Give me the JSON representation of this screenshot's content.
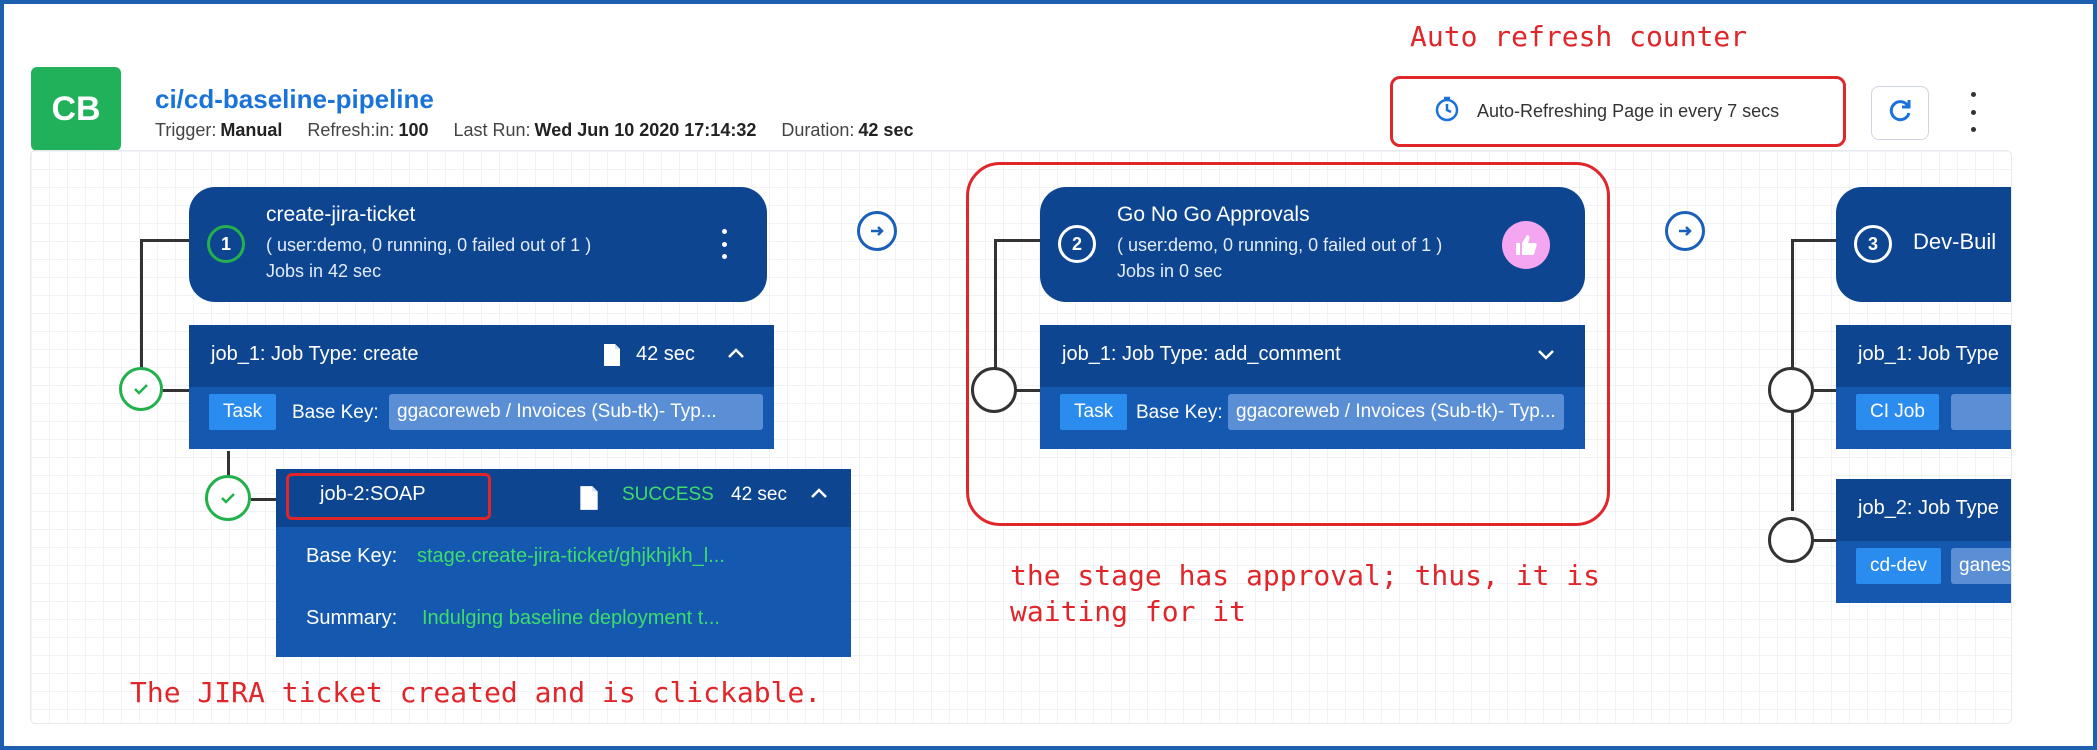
{
  "header": {
    "logo_text": "CB",
    "title": "ci/cd-baseline-pipeline",
    "trigger_label": "Trigger:",
    "trigger_value": "Manual",
    "refresh_label": "Refresh:in:",
    "refresh_value": "100",
    "last_run_label": "Last Run:",
    "last_run_value": "Wed Jun 10 2020 17:14:32",
    "duration_label": "Duration:",
    "duration_value": "42 sec",
    "auto_refresh_text": "Auto-Refreshing Page in every 7 secs",
    "icons": {
      "timer": "clock-icon",
      "refresh": "refresh-icon",
      "more": "kebab-menu-icon"
    }
  },
  "stages": [
    {
      "number": "1",
      "name": "create-jira-ticket",
      "summary": "( user:demo, 0 running, 0 failed out of 1 )",
      "jobs_time": "Jobs in 42 sec",
      "jobs": [
        {
          "title": "job_1: Job Type: create",
          "duration": "42 sec",
          "tag": "Task",
          "base_key_label": "Base Key:",
          "base_key_value": "ggacoreweb / Invoices (Sub-tk)- Typ..."
        }
      ],
      "subjob": {
        "title": "job-2:SOAP",
        "status": "SUCCESS",
        "duration": "42 sec",
        "base_key_label": "Base Key:",
        "base_key_value": "stage.create-jira-ticket/ghjkhjkh_l...",
        "summary_label": "Summary:",
        "summary_value": "Indulging baseline deployment t..."
      }
    },
    {
      "number": "2",
      "name": "Go No Go Approvals",
      "summary": "( user:demo, 0 running, 0 failed out of 1 )",
      "jobs_time": "Jobs in 0 sec",
      "jobs": [
        {
          "title": "job_1: Job Type: add_comment",
          "tag": "Task",
          "base_key_label": "Base Key:",
          "base_key_value": "ggacoreweb / Invoices (Sub-tk)- Typ..."
        }
      ]
    },
    {
      "number": "3",
      "name": "Dev-Buil",
      "jobs": [
        {
          "title": "job_1: Job Type",
          "tag": "CI Job"
        },
        {
          "title": "job_2: Job Type",
          "tag": "cd-dev",
          "field": "ganes"
        }
      ]
    }
  ],
  "annotations": {
    "auto_refresh": "Auto refresh counter",
    "approval": "the stage has approval; thus, it is waiting for it",
    "jira": "The JIRA ticket created and is clickable."
  },
  "colors": {
    "brand_green": "#21b15a",
    "stage_blue": "#0e4590",
    "job_row_blue": "#1558b0",
    "tag_blue": "#2b8cf0",
    "success_green": "#3ddc6b",
    "annotation_red": "#e0262b",
    "title_blue": "#1a73d9"
  }
}
